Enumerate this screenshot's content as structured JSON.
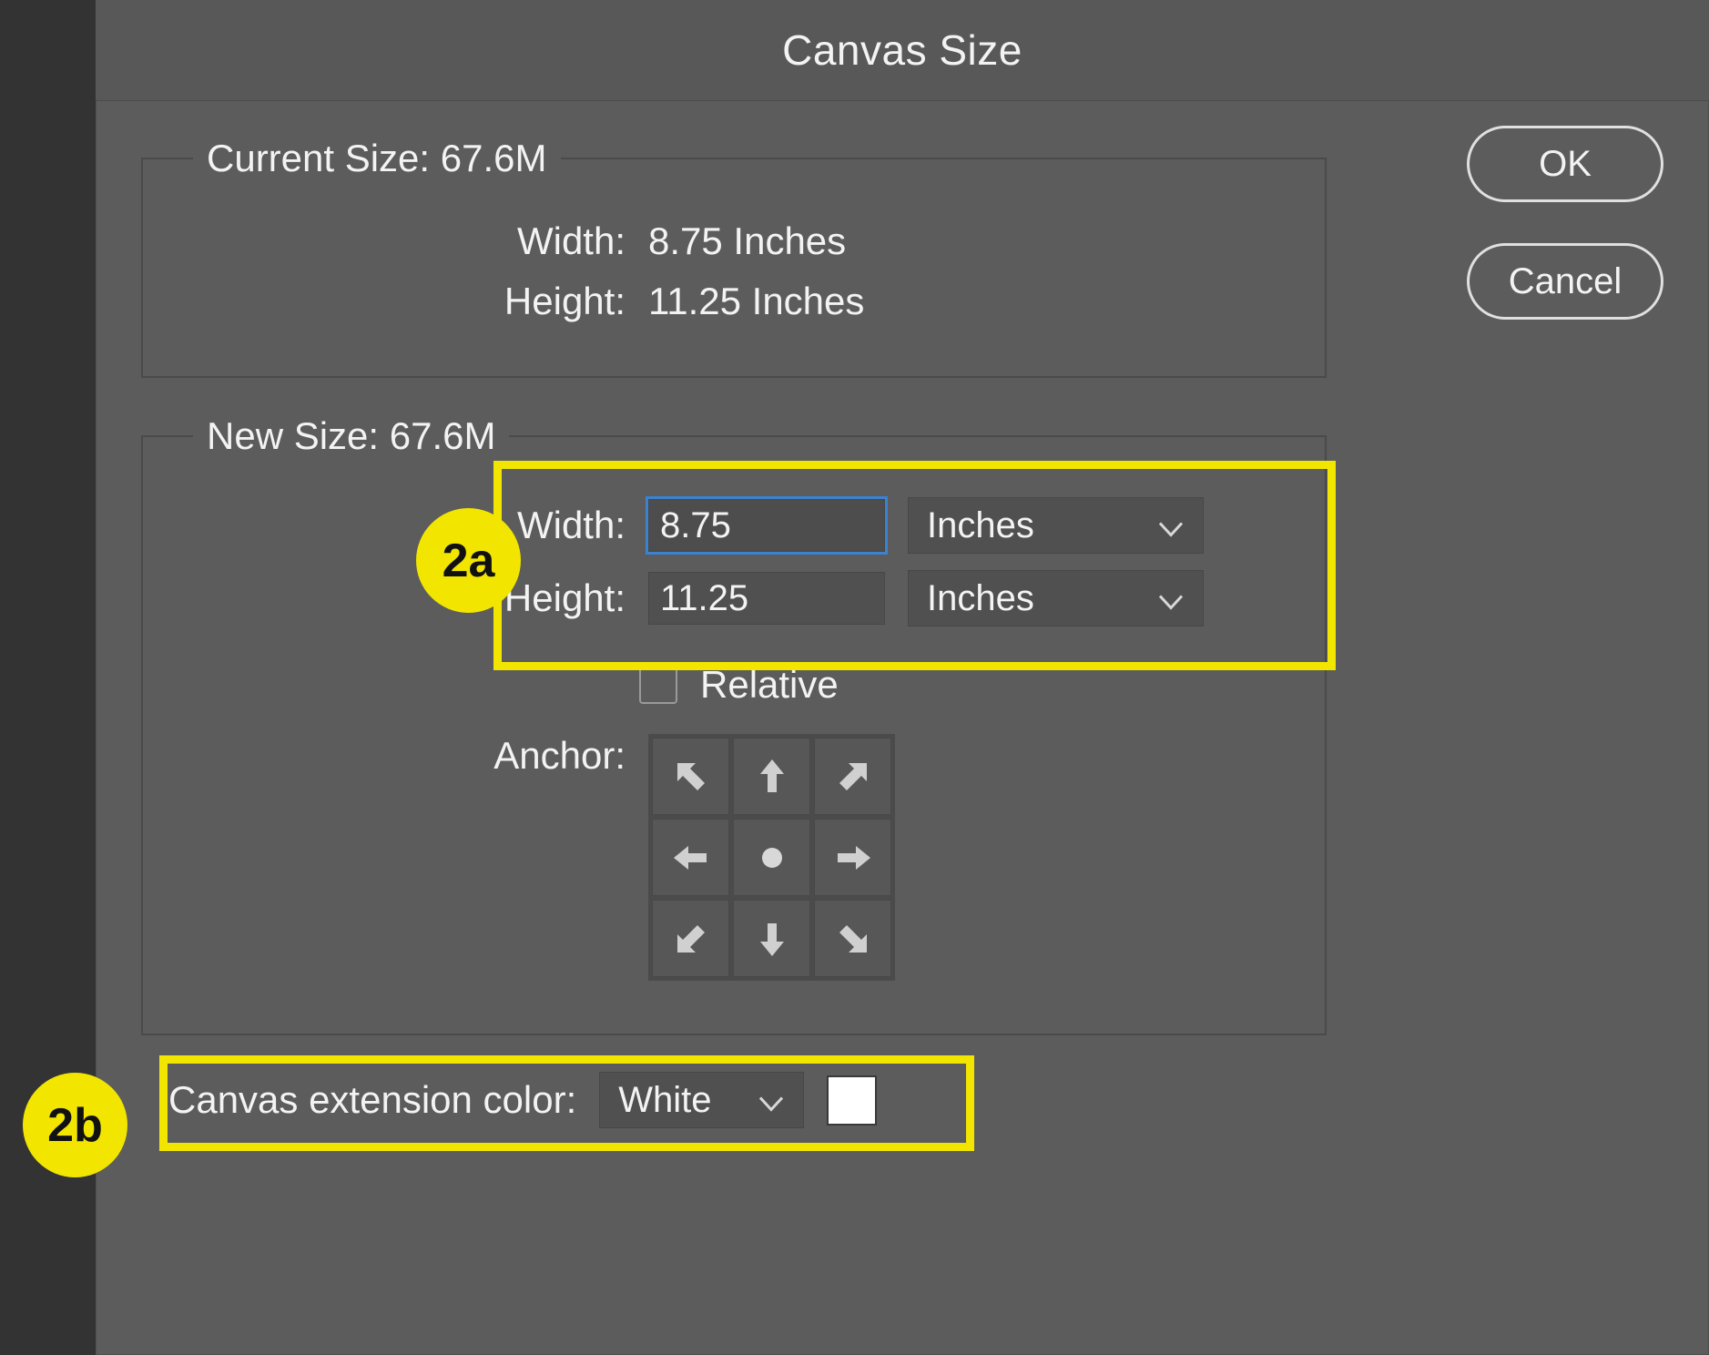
{
  "dialog": {
    "title": "Canvas Size",
    "buttons": {
      "ok": "OK",
      "cancel": "Cancel"
    }
  },
  "current": {
    "legend": "Current Size: 67.6M",
    "width_label": "Width:",
    "width_value": "8.75 Inches",
    "height_label": "Height:",
    "height_value": "11.25 Inches"
  },
  "newsize": {
    "legend": "New Size: 67.6M",
    "width_label": "Width:",
    "width_value": "8.75",
    "width_units": "Inches",
    "height_label": "Height:",
    "height_value": "11.25",
    "height_units": "Inches",
    "relative_label": "Relative",
    "relative_checked": false,
    "anchor_label": "Anchor:",
    "anchor_position": "center"
  },
  "extension": {
    "label": "Canvas extension color:",
    "value": "White",
    "swatch_color": "#ffffff"
  },
  "callouts": {
    "a": "2a",
    "b": "2b"
  }
}
